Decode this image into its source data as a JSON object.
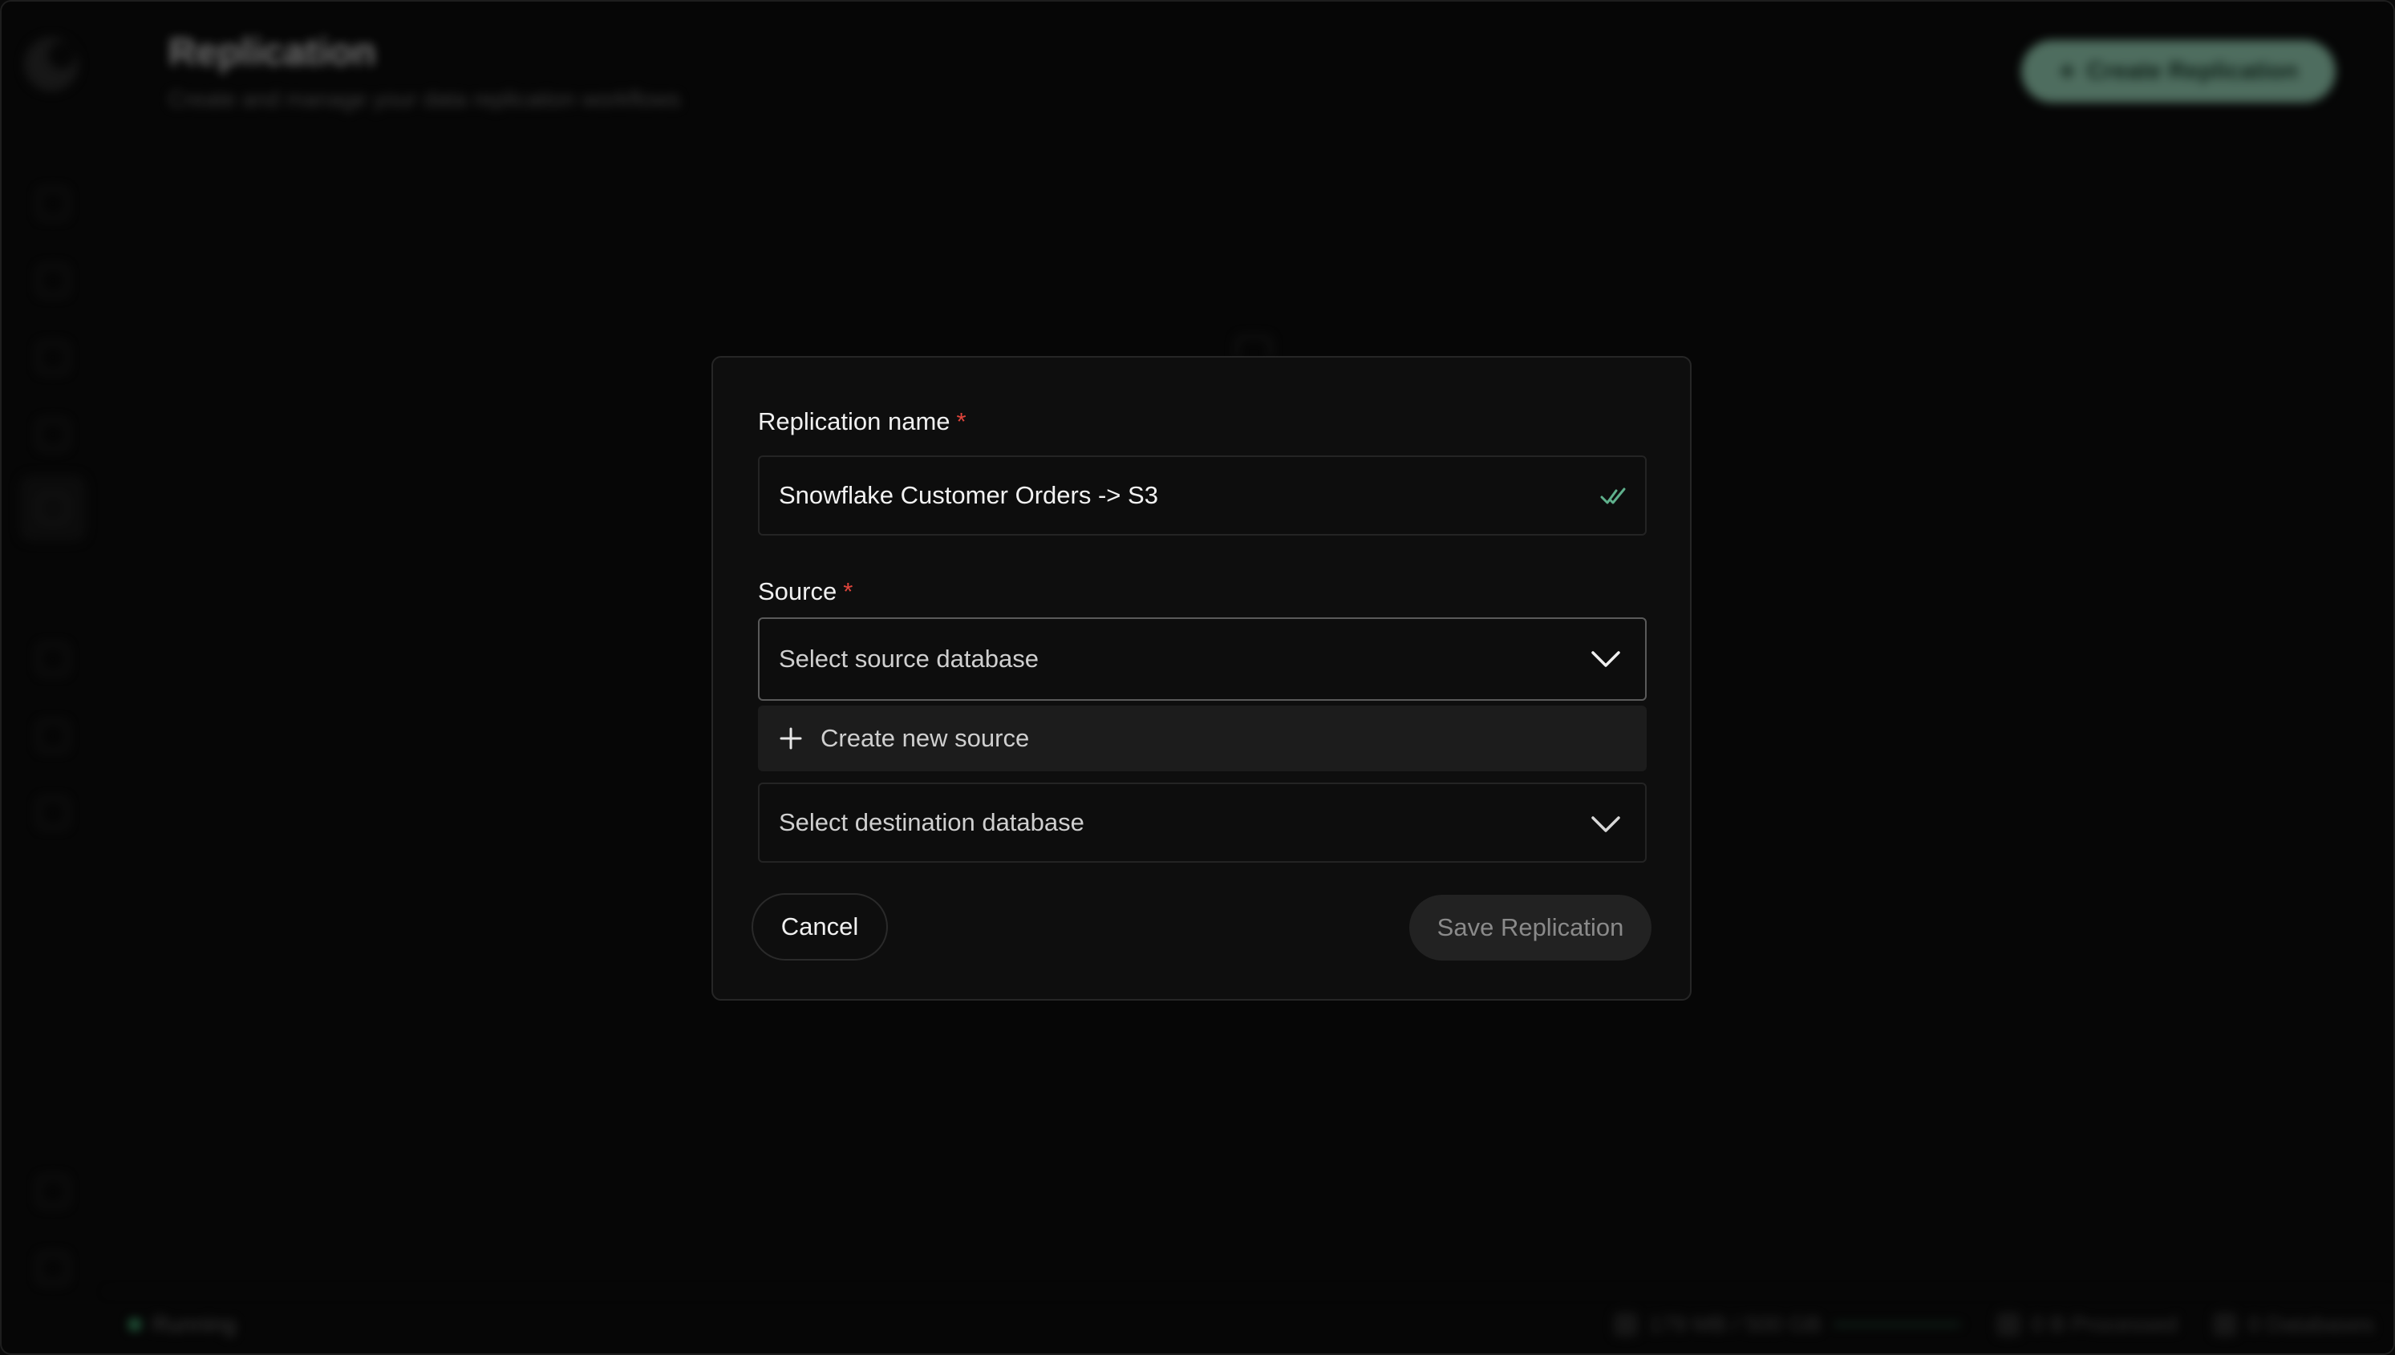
{
  "header": {
    "title": "Replication",
    "subtitle": "Create and manage your data replication workflows",
    "create_button": "Create Replication"
  },
  "statusbar": {
    "status": "Running",
    "memory": "179 MB / 500 GB",
    "processed": "0 B Processed",
    "databases": "0 Databases"
  },
  "dialog": {
    "name_label": "Replication name",
    "required_mark": "*",
    "name_value": "Snowflake Customer Orders -> S3",
    "source_label": "Source",
    "source_placeholder": "Select source database",
    "create_source_option": "Create new source",
    "destination_placeholder": "Select destination database",
    "cancel_label": "Cancel",
    "save_label": "Save Replication"
  },
  "colors": {
    "accent": "#8fc7ad",
    "required": "#e0453c",
    "valid_check": "#5fb08c"
  },
  "icons": [
    "app-logo-icon",
    "home-icon",
    "database-icon",
    "history-icon",
    "play-icon",
    "replication-icon",
    "settings-icon",
    "tools-icon",
    "link-icon",
    "help-icon",
    "logout-icon",
    "check-icon",
    "chevron-down-icon",
    "plus-icon"
  ]
}
